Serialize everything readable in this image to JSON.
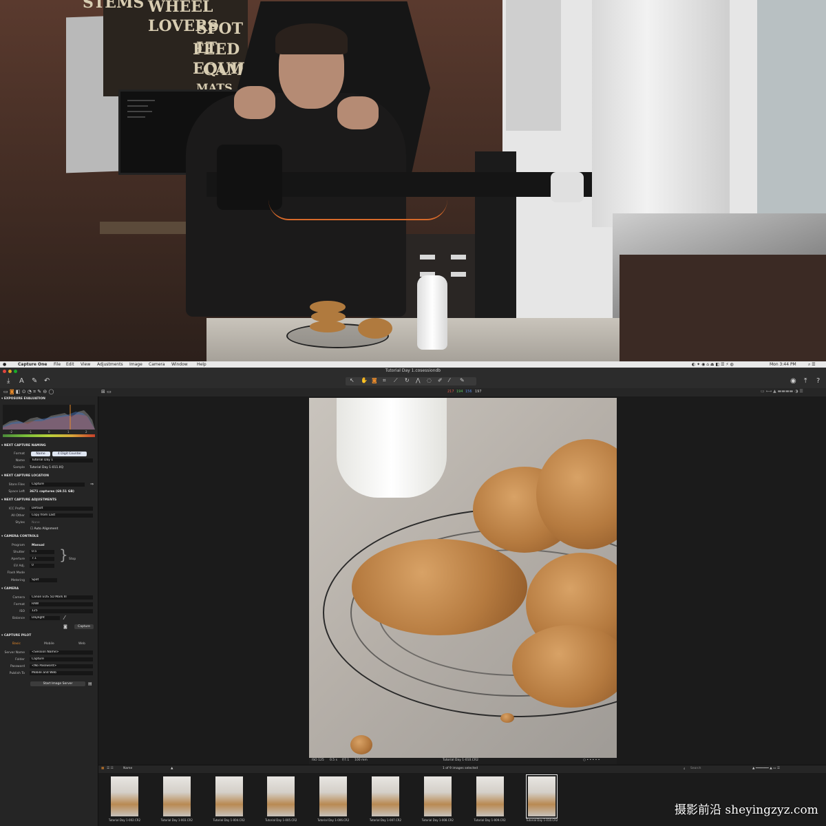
{
  "menubar": {
    "app": "Capture One",
    "items": [
      "File",
      "Edit",
      "View",
      "Adjustments",
      "Image",
      "Camera",
      "Window",
      "Help"
    ],
    "clock": "Mon 3:44 PM"
  },
  "toolbar": {
    "doc_title": "Tutorial Day 1.cosessiondb"
  },
  "subbar": {
    "rgb": [
      "217",
      "194",
      "156",
      "197"
    ]
  },
  "studio": {
    "sign_lines": [
      "STEMS",
      "WHEEL LOVERS",
      "SPOT LT",
      "FEED EQUIP",
      "CAMS",
      "MATS"
    ]
  },
  "panel": {
    "exposure": {
      "title": "EXPOSURE EVALUATION",
      "scale": [
        "-2",
        "-1",
        "0",
        "1",
        "2"
      ]
    },
    "naming": {
      "title": "NEXT CAPTURE NAMING",
      "format_label": "Format",
      "format_tokens": [
        "Name",
        "4 Digit Counter"
      ],
      "name_label": "Name",
      "name_value": "Tutorial Day 1",
      "sample_label": "Sample",
      "sample_value": "Tutorial Day 1-011.IIQ"
    },
    "location": {
      "title": "NEXT CAPTURE LOCATION",
      "store_label": "Store Files",
      "store_value": "Capture",
      "space_label": "Space Left",
      "space_value": "3671 captures (69.51 GB)"
    },
    "adjust": {
      "title": "NEXT CAPTURE ADJUSTMENTS",
      "icc_label": "ICC Profile",
      "icc_value": "Default",
      "other_label": "All Other",
      "other_value": "Copy from Last",
      "styles_label": "Styles",
      "styles_value": "None",
      "auto_align": "Auto Alignment"
    },
    "camera_controls": {
      "title": "CAMERA CONTROLS",
      "program_label": "Program",
      "program_value": "Manual",
      "shutter_label": "Shutter",
      "shutter_value": "0.5",
      "aperture_label": "Aperture",
      "aperture_value": "7.1",
      "ev_label": "EV Adj.",
      "ev_value": "0",
      "flash_label": "Flash Mode",
      "flash_value": "",
      "metering_label": "Metering",
      "metering_value": "Spot",
      "stop": "Stop"
    },
    "camera": {
      "title": "CAMERA",
      "camera_label": "Camera",
      "camera_value": "Canon EOS 5D Mark III",
      "format_label": "Format",
      "format_value": "RAW",
      "iso_label": "ISO",
      "iso_value": "125",
      "balance_label": "Balance",
      "balance_value": "Daylight",
      "capture_button": "Capture"
    },
    "pilot": {
      "title": "CAPTURE PILOT",
      "tabs": [
        "Basic",
        "Mobile",
        "Web"
      ],
      "server_label": "Server Name",
      "server_value": "<Session Name>",
      "folder_label": "Folder",
      "folder_value": "Capture",
      "password_label": "Password",
      "password_value": "<No Password>",
      "publish_label": "Publish To",
      "publish_value": "Mobile and Web",
      "start_button": "Start Image Server"
    }
  },
  "viewer": {
    "meta": [
      "ISO 125",
      "0.5 s",
      "f/7.1",
      "100 mm"
    ],
    "filename": "Tutorial Day 1-010.CR2"
  },
  "browser": {
    "sort_value": "Name",
    "count": "1 of 9 images selected",
    "search_placeholder": "Search",
    "thumbs": [
      "Tutorial Day 1-002.CR2",
      "Tutorial Day 1-003.CR2",
      "Tutorial Day 1-004.CR2",
      "Tutorial Day 1-005.CR2",
      "Tutorial Day 1-006.CR2",
      "Tutorial Day 1-007.CR2",
      "Tutorial Day 1-008.CR2",
      "Tutorial Day 1-009.CR2",
      "Tutorial Day 1-010.CR2"
    ],
    "selected_index": 8
  },
  "watermark": "摄影前沿 sheyingzyz.com",
  "colors": {
    "accent": "#e88a2a",
    "panel": "#252525",
    "viewer": "#1b1b1b"
  }
}
